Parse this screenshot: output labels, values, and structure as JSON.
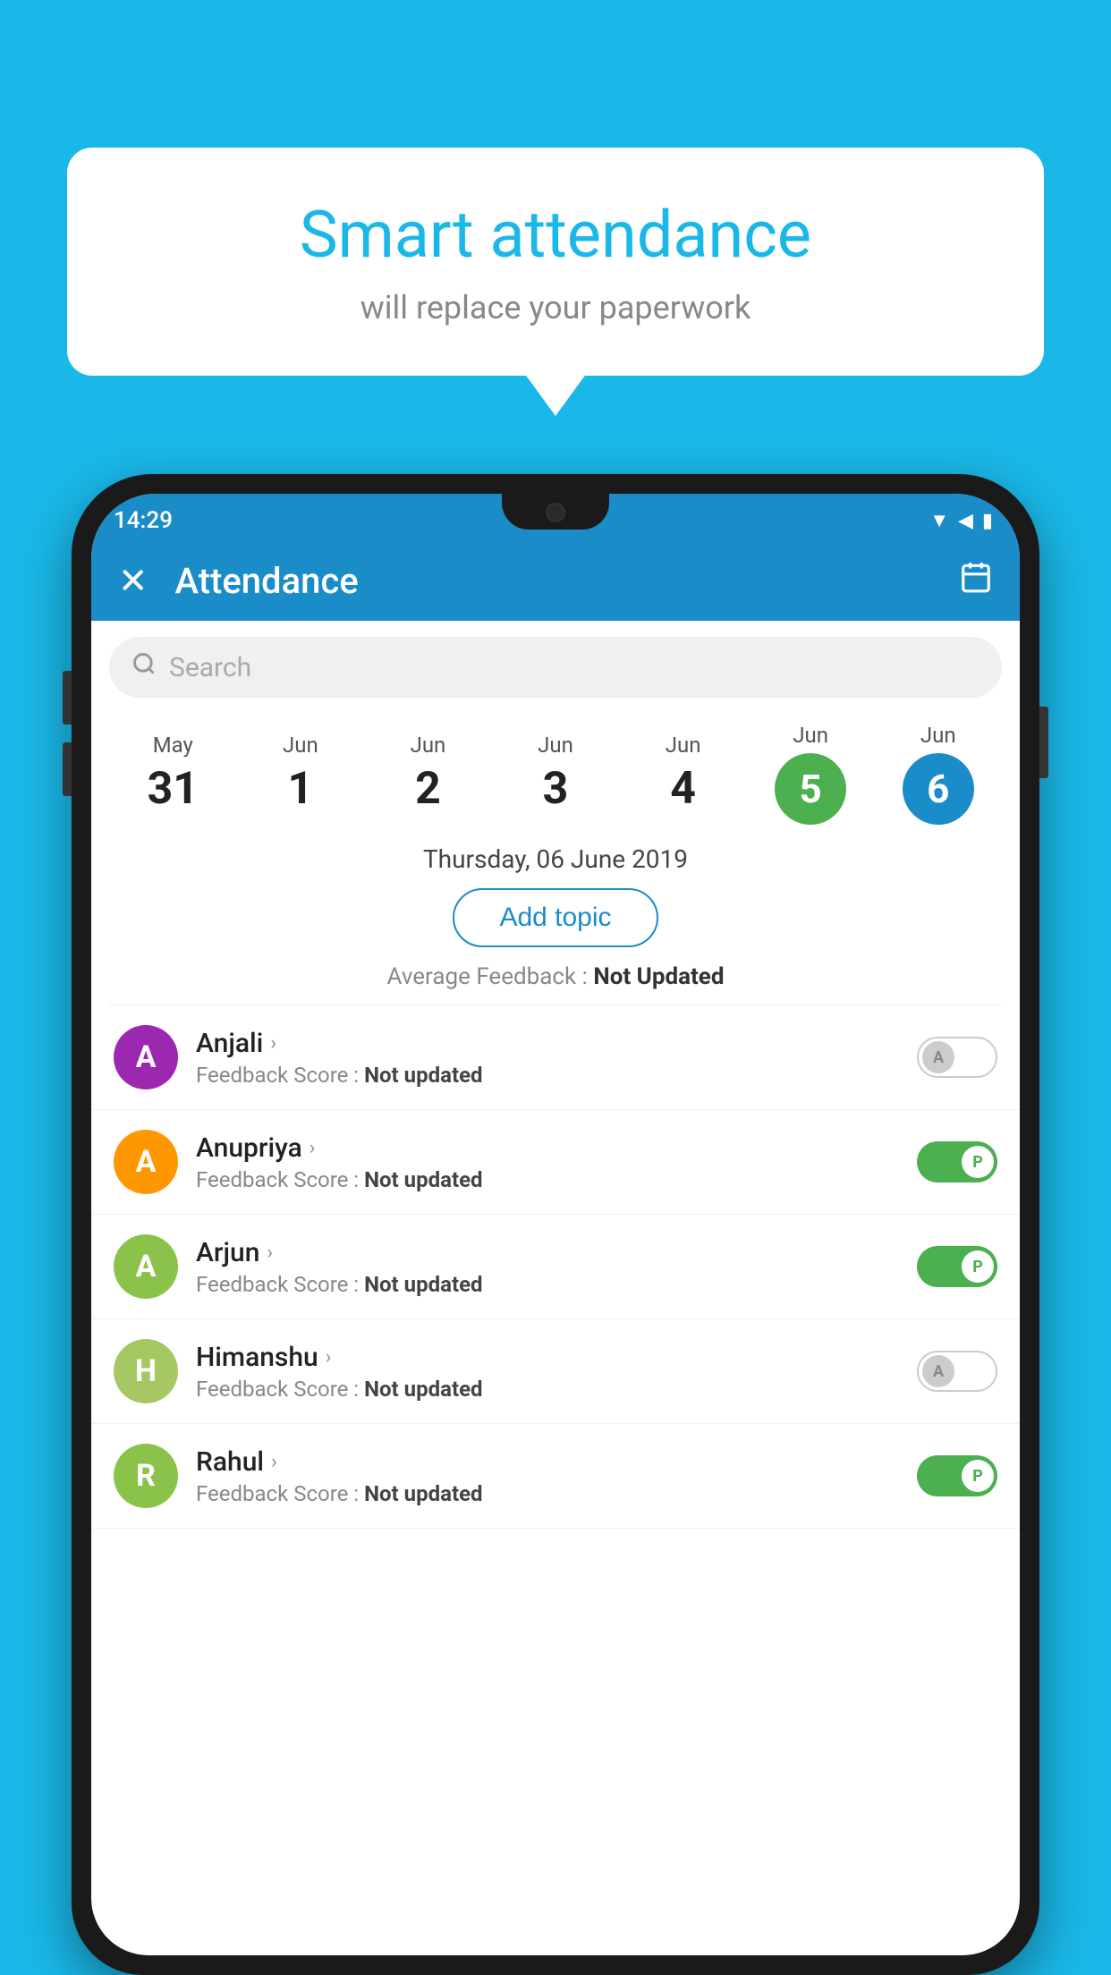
{
  "background_color": "#1ab8e8",
  "bubble": {
    "title": "Smart attendance",
    "subtitle": "will replace your paperwork"
  },
  "status_bar": {
    "time": "14:29",
    "icons": [
      "wifi",
      "signal",
      "battery"
    ]
  },
  "header": {
    "title": "Attendance",
    "close_label": "✕",
    "calendar_label": "📅"
  },
  "search": {
    "placeholder": "Search"
  },
  "dates": [
    {
      "month": "May",
      "day": "31",
      "selected": false
    },
    {
      "month": "Jun",
      "day": "1",
      "selected": false
    },
    {
      "month": "Jun",
      "day": "2",
      "selected": false
    },
    {
      "month": "Jun",
      "day": "3",
      "selected": false
    },
    {
      "month": "Jun",
      "day": "4",
      "selected": false
    },
    {
      "month": "Jun",
      "day": "5",
      "selected": "green"
    },
    {
      "month": "Jun",
      "day": "6",
      "selected": "blue"
    }
  ],
  "selected_date_label": "Thursday, 06 June 2019",
  "add_topic_label": "Add topic",
  "avg_feedback_label": "Average Feedback :",
  "avg_feedback_value": "Not Updated",
  "students": [
    {
      "name": "Anjali",
      "initial": "A",
      "avatar_color": "purple",
      "feedback": "Feedback Score : Not updated",
      "attendance": "absent"
    },
    {
      "name": "Anupriya",
      "initial": "A",
      "avatar_color": "orange",
      "feedback": "Feedback Score : Not updated",
      "attendance": "present"
    },
    {
      "name": "Arjun",
      "initial": "A",
      "avatar_color": "green",
      "feedback": "Feedback Score : Not updated",
      "attendance": "present"
    },
    {
      "name": "Himanshu",
      "initial": "H",
      "avatar_color": "light-green",
      "feedback": "Feedback Score : Not updated",
      "attendance": "absent"
    },
    {
      "name": "Rahul",
      "initial": "R",
      "avatar_color": "green",
      "feedback": "Feedback Score : Not updated",
      "attendance": "present"
    }
  ]
}
